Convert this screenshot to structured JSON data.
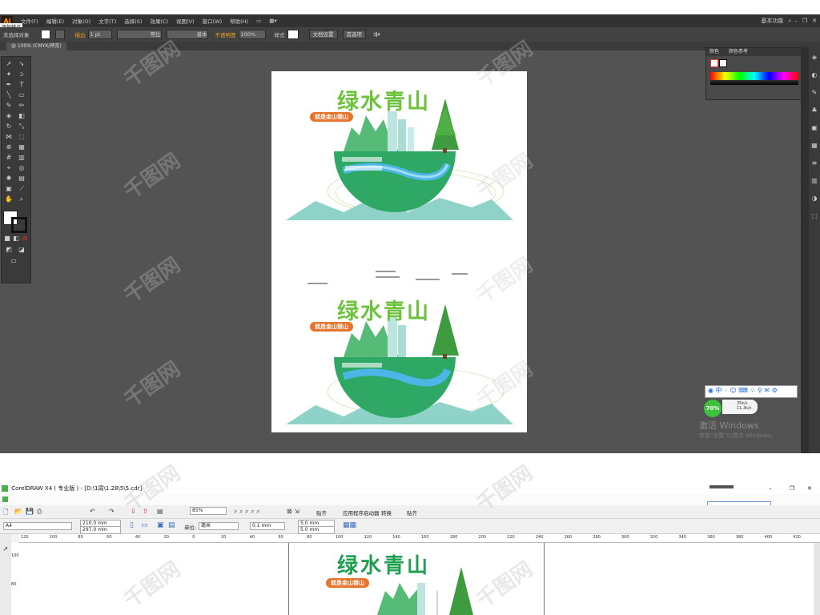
{
  "illustrator": {
    "logo": "Ai",
    "menus": [
      "文件(F)",
      "编辑(E)",
      "对象(O)",
      "文字(T)",
      "选择(S)",
      "效果(C)",
      "视图(V)",
      "窗口(W)",
      "帮助(H)"
    ],
    "workspace": "基本功能",
    "tooltip": "添加锚点",
    "toolbar": {
      "selection": "未选择对象",
      "stroke_label": "描边",
      "stroke_value": "1 pt",
      "line_profile": "等比",
      "brush": "基本",
      "opacity_label": "不透明度",
      "opacity_value": "100%",
      "style_label": "样式",
      "doc_setup": "文档设置",
      "preferences": "首选项"
    },
    "tab_label": "@ 100% (CMYK/预览)",
    "color_panel": {
      "tab1": "颜色",
      "tab2": "颜色参考"
    }
  },
  "artwork": {
    "title": "绿水青山",
    "subtitle": "就是金山银山",
    "title_color": "#6cc23c",
    "title_color2": "#3a4aa8",
    "badge_color": "#e8732a"
  },
  "float_widget": {
    "percent": "70%",
    "up": "35k/s",
    "down": "11.3k/s"
  },
  "windows_watermark": {
    "line1": "激活 Windows",
    "line2": "转到\"设置\"以激活 Windows。"
  },
  "watermark_text": "千图网",
  "coreldraw": {
    "title": "CorelDRAW X4 ( 专业版 ) - [D:\\1周\\1.28\\5\\5.cdr]",
    "tb1": {
      "zoom": "85%",
      "snap": "贴齐",
      "options": "应用程序启动器",
      "transform": "转换",
      "paste": "贴齐"
    },
    "tb2": {
      "paper": "A4",
      "width": "210.0 mm",
      "height": "297.0 mm",
      "units_label": "单位:",
      "units": "毫米",
      "nudge": "0.1 mm",
      "dup_x": "5.0 mm",
      "dup_y": "5.0 mm"
    },
    "ruler_marks": [
      "120",
      "100",
      "80",
      "60",
      "40",
      "20",
      "0",
      "20",
      "40",
      "60",
      "80",
      "100",
      "120",
      "140",
      "160",
      "180",
      "200",
      "220",
      "240",
      "260",
      "280",
      "300",
      "320",
      "340",
      "360",
      "380",
      "400",
      "420"
    ]
  }
}
